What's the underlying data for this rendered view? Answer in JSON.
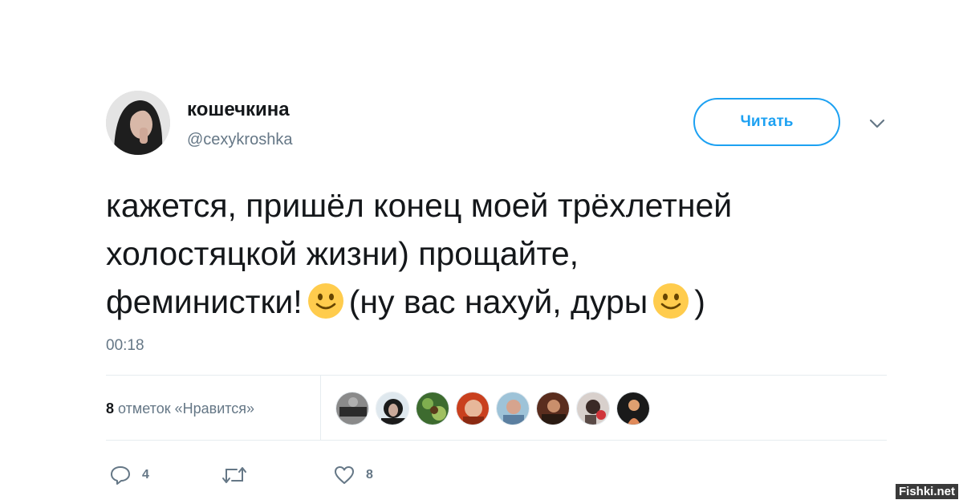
{
  "user": {
    "display_name": "кошечкина",
    "handle": "@cexykroshka"
  },
  "follow_button": {
    "label": "Читать"
  },
  "tweet": {
    "line1": "кажется, пришёл конец моей трёхлетней",
    "line2": "холостяцкой жизни) прощайте,",
    "line3_a": "феминистки!",
    "line3_b": "(ну вас нахуй, дуры",
    "line3_c": ")",
    "emoji": "slightly-smiling-face",
    "timestamp": "00:18"
  },
  "likes": {
    "count": "8",
    "label": "отметок «Нравится»",
    "liker_count": 8
  },
  "actions": {
    "reply_count": "4",
    "retweet_count": "",
    "like_count": "8"
  },
  "watermark": "Fishki.net",
  "colors": {
    "accent": "#1da1f2",
    "secondary_text": "#657786",
    "primary_text": "#14171a",
    "divider": "#e6ecf0",
    "emoji_yellow": "#ffcc4d"
  }
}
